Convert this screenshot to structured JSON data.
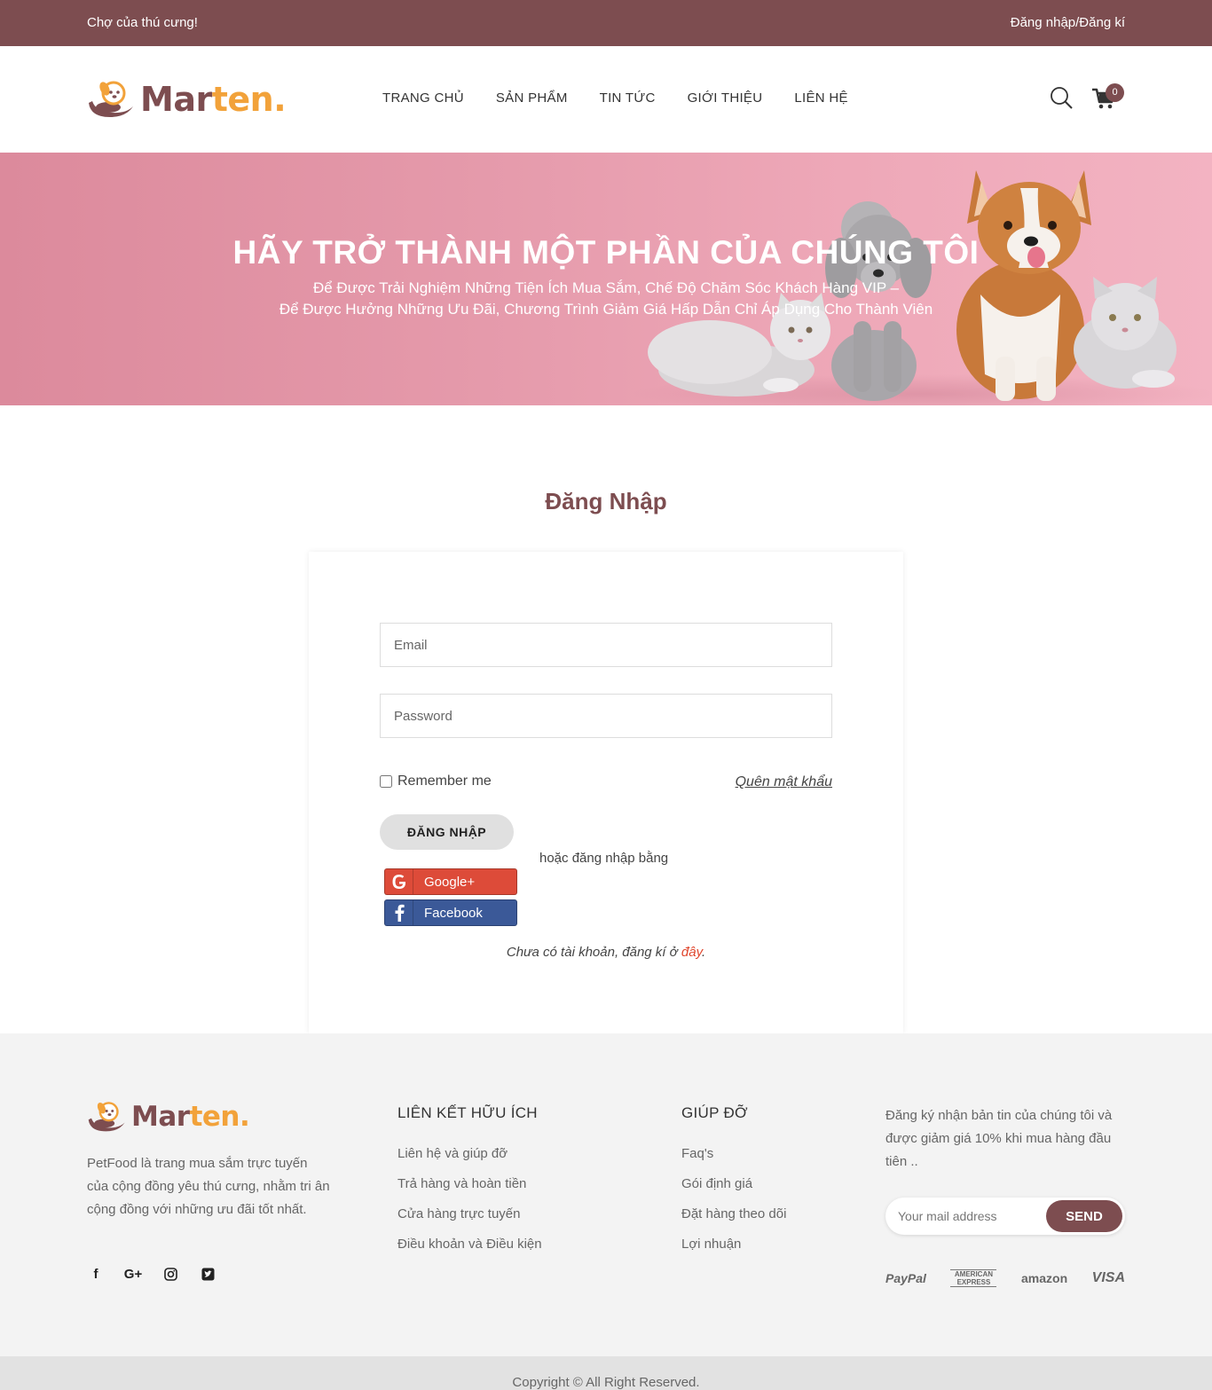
{
  "topbar": {
    "tagline": "Chợ của thú cưng!",
    "auth_link": "Đăng nhập/Đăng kí"
  },
  "header": {
    "logo": {
      "part1": "Mar",
      "part2": "ten."
    },
    "nav": [
      {
        "label": "TRANG CHỦ"
      },
      {
        "label": "SẢN PHẨM"
      },
      {
        "label": "TIN TỨC"
      },
      {
        "label": "GIỚI THIỆU"
      },
      {
        "label": "LIÊN HỆ"
      }
    ],
    "cart_count": "0"
  },
  "hero": {
    "title": "HÃY TRỞ THÀNH MỘT PHẦN CỦA CHÚNG TÔI",
    "subtitle_line1": "Để Được Trải Nghiệm Những Tiện Ích Mua Sắm, Chế Độ Chăm Sóc Khách Hàng VIP –",
    "subtitle_line2": "Để Được Hưởng Những Ưu Đãi, Chương Trình Giảm Giá Hấp Dẫn Chỉ Áp Dụng Cho Thành Viên"
  },
  "login": {
    "title": "Đăng Nhập",
    "email_placeholder": "Email",
    "password_placeholder": "Password",
    "remember_label": "Remember me",
    "forgot_label": "Quên mật khẩu",
    "submit_label": "ĐĂNG NHẬP",
    "or_text": "hoặc đăng nhập bằng",
    "google_label": "Google+",
    "facebook_label": "Facebook",
    "signup_text": "Chưa có tài khoản, đăng kí ở ",
    "signup_link": "đây",
    "signup_end": "."
  },
  "footer": {
    "logo": {
      "part1": "Mar",
      "part2": "ten."
    },
    "about": "PetFood là trang mua sắm trực tuyến của cộng đồng yêu thú cưng, nhằm tri ân cộng đồng với những ưu đãi tốt nhất.",
    "social_icons": [
      "facebook-icon",
      "google-plus-icon",
      "instagram-icon",
      "twitter-icon"
    ],
    "links_title": "LIÊN KẾT HỮU ÍCH",
    "links": [
      {
        "label": "Liên hệ và giúp đỡ"
      },
      {
        "label": "Trả hàng và hoàn tiền"
      },
      {
        "label": "Cửa hàng trực tuyến"
      },
      {
        "label": "Điều khoản và Điều kiện"
      }
    ],
    "help_title": "GIÚP ĐỠ",
    "help": [
      {
        "label": "Faq's"
      },
      {
        "label": "Gói định giá"
      },
      {
        "label": "Đặt hàng theo dõi"
      },
      {
        "label": "Lợi nhuận"
      }
    ],
    "newsletter_text": "Đăng ký nhận bản tin của chúng tôi và được giảm giá 10% khi mua hàng đầu tiên ..",
    "newsletter_placeholder": "Your mail address",
    "send_label": "SEND",
    "payments": {
      "paypal": "PayPal",
      "amex": "AMERICAN EXPRESS",
      "amazon": "amazon",
      "visa": "VISA"
    },
    "copyright": "Copyright © All Right Reserved."
  },
  "colors": {
    "brand": "#7d4d50",
    "accent": "#f2a23a",
    "google": "#dd4b39",
    "facebook": "#3b5998",
    "link_red": "#e0472e"
  }
}
